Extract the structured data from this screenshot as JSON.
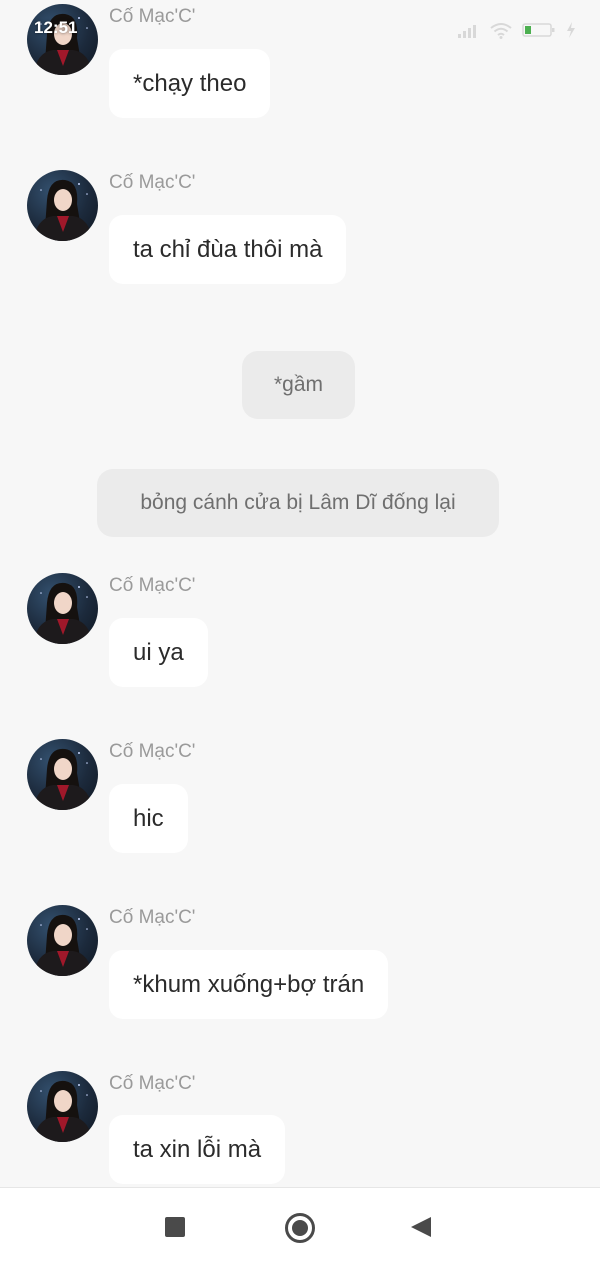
{
  "status_bar": {
    "time": "12:51",
    "icons": [
      "signal-icon",
      "wifi-icon",
      "battery-icon",
      "charging-icon"
    ],
    "battery_color": "#4caf50"
  },
  "messages": [
    {
      "type": "character",
      "sender": "Cố Mạc'C'",
      "text": "*chạy theo"
    },
    {
      "type": "character",
      "sender": "Cố Mạc'C'",
      "text": "ta chỉ đùa thôi mà"
    },
    {
      "type": "narration",
      "text": "*gầm"
    },
    {
      "type": "narration",
      "text": "bỏng cánh cửa bị Lâm Dĩ đống lại"
    },
    {
      "type": "character",
      "sender": "Cố Mạc'C'",
      "text": "ui ya"
    },
    {
      "type": "character",
      "sender": "Cố Mạc'C'",
      "text": "hic"
    },
    {
      "type": "character",
      "sender": "Cố Mạc'C'",
      "text": "*khum xuống+bợ trán"
    },
    {
      "type": "character",
      "sender": "Cố Mạc'C'",
      "text": "ta xin lỗi mà"
    }
  ],
  "nav_bar": {
    "buttons": [
      "recent-apps-button",
      "home-button",
      "back-button"
    ]
  }
}
